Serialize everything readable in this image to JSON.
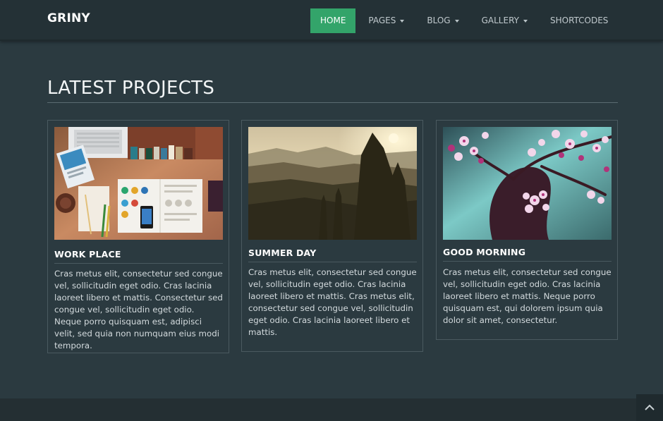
{
  "brand": "GRINY",
  "nav": {
    "items": [
      {
        "label": "HOME"
      },
      {
        "label": "PAGES"
      },
      {
        "label": "BLOG"
      },
      {
        "label": "GALLERY"
      },
      {
        "label": "SHORTCODES"
      }
    ]
  },
  "section": {
    "title": "LATEST PROJECTS"
  },
  "projects": [
    {
      "title": "WORK PLACE",
      "text": "Cras metus elit, consectetur sed congue vel, sollicitudin eget odio. Cras lacinia laoreet libero et mattis. Consectetur sed congue vel, sollicitudin eget odio. Neque porro quisquam est, adipisci velit, sed quia non numquam eius modi tempora."
    },
    {
      "title": "SUMMER DAY",
      "text": "Cras metus elit, consectetur sed congue vel, sollicitudin eget odio. Cras lacinia laoreet libero et mattis. Cras metus elit, consectetur sed congue vel, sollicitudin eget odio. Cras lacinia laoreet libero et mattis."
    },
    {
      "title": "GOOD MORNING",
      "text": "Cras metus elit, consectetur sed congue vel, sollicitudin eget odio. Cras lacinia laoreet libero et mattis. Neque porro quisquam est, qui dolorem ipsum quia dolor sit amet, consectetur."
    }
  ],
  "colors": {
    "background": "#2b3a40",
    "navbar": "#243136",
    "accent": "#33a46a"
  },
  "icons": {
    "back_to_top": "chevron-up-icon"
  }
}
